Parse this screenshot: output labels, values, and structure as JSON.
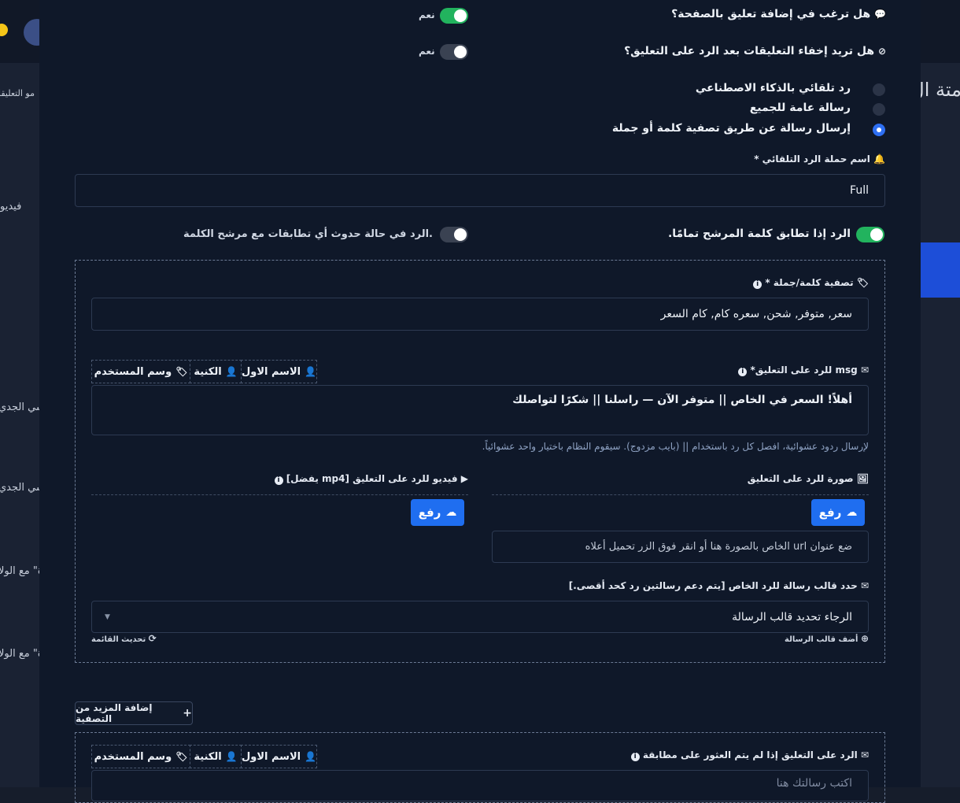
{
  "background": {
    "left_labels": [
      "مو التعليقا",
      "فيديو",
      "اسي الجدي",
      "اسي الجدي",
      "ة\" مع الولا",
      "ة\" مع الولا"
    ],
    "title_fragment": "متة ال"
  },
  "form": {
    "q_add_comment": "هل ترغب في إضافة تعليق بالصفحة؟",
    "q_add_comment_value": "نعم",
    "q_hide_comments": "هل تريد إخفاء التعليقات بعد الرد على التعليق؟",
    "q_hide_comments_value": "نعم",
    "radios": [
      {
        "label": "رد تلقائي بالذكاء الاصطناعي",
        "checked": false
      },
      {
        "label": "رسالة عامة للجميع",
        "checked": false
      },
      {
        "label": "إرسال رسالة عن طريق تصفية كلمة أو جملة",
        "checked": true
      }
    ],
    "campaign_label": "اسم حملة الرد التلقائي *",
    "campaign_value": "Full",
    "exact_match_label": "الرد إذا تطابق كلمة المرشح تمامًا.",
    "partial_match_label": "الرد في حالة حدوث أي تطابقات مع مرشح الكلمة.",
    "filter_label": "تصفية كلمة/جملة *",
    "filter_value": "سعر, متوفر, شحن, سعره كام, كام السعر",
    "msg_label": "msg للرد على التعليق*",
    "tag_first_name": "الاسم الاول",
    "tag_last_name": "الكنية",
    "tag_user_tag": "وسم المستخدم",
    "msg_value": "أهلاً! السعر في الخاص || متوفر الآن — راسلنا || شكرًا لتواصلك",
    "msg_hint": "لإرسال ردود عشوائية، افصل كل رد باستخدام || (بايب مزدوج). سيقوم النظام باختيار واحد عشوائياً.",
    "image_label": "صورة للرد على التعليق",
    "video_label": "فيديو للرد على التعليق [mp4 يفضل]",
    "upload_label": "رفع",
    "image_url_placeholder": "ضع عنوان url الخاص بالصورة هنا أو انقر فوق الزر تحميل أعلاه",
    "template_label": "حدد قالب رسالة للرد الخاص [يتم دعم رسالتين رد كحد أقصى.]",
    "template_value": "الرجاء تحديد قالب الرسالة",
    "add_template": "أضف قالب الرسالة",
    "refresh_list": "تحديث القائمة",
    "add_more_filter": "إضافة المزيد من التصفية",
    "no_match_label": "الرد على التعليق إذا لم يتم العثور على مطابقة",
    "no_match_placeholder": "اكتب رسالتك هنا"
  },
  "colors": {
    "accent": "#1f6ef0",
    "toggle_on": "#22b35e",
    "modal_bg": "#0f1829"
  }
}
